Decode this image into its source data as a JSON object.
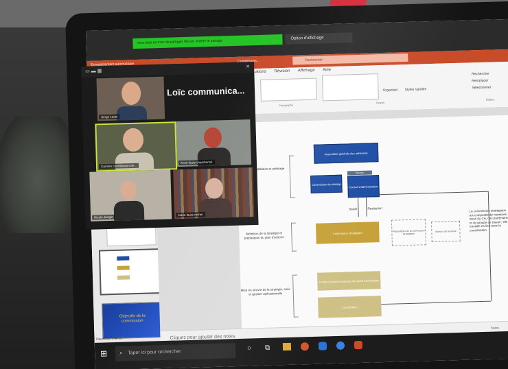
{
  "zoom": {
    "share_bar_text": "Vous êtes en train de partager l'écran. Arrêter le partage",
    "view_options_label": "Option d'affichage",
    "featured_name": "Loïc communica...",
    "participants": [
      {
        "label": "Serge Lavet",
        "tile": "top"
      },
      {
        "label": "Carmen coordination de...",
        "tile": "mid-left"
      },
      {
        "label": "Anne-laure chambenoit",
        "tile": "mid-right"
      },
      {
        "label": "Nicole dengle",
        "tile": "bottom-left"
      },
      {
        "label": "marie-laure rocher",
        "tile": "bottom-right"
      }
    ]
  },
  "powerpoint": {
    "autosave_label": "Enregistrement automatique",
    "doc_title": "Comitésions...",
    "search_placeholder": "Rechercher",
    "tabs": [
      "...ations",
      "Révision",
      "Affichage",
      "Aide"
    ],
    "ribbon_groups": {
      "paragraph": "Paragraphe",
      "drawing": "Dessin",
      "editing": "Édition"
    },
    "ribbon_buttons": {
      "organize": "Organiser",
      "styles": "Styles rapides",
      "find": "Rechercher",
      "replace": "Remplacer",
      "select": "Sélectionner"
    },
    "thumbnail_last_title": "Objectifs de la commission",
    "notes_placeholder": "Cliquez pour ajouter des notes",
    "status_slide": "Diapositive 2 de 10",
    "status_notes": "Notes",
    "slide": {
      "row1_label": "Décisions, validation et arbitrage",
      "row2_label": "Définition de la stratégie et préparation du plan d'actions",
      "row3_label": "Mise en oeuvre de la stratégie, suivi et gestion opérationnelle",
      "box_top": "Assemblée générale des adhérents",
      "box_left": "Commission de pilotage",
      "box_right": "Conseil d'administration",
      "box_mid_tag": "Bureau",
      "box_gold": "Commission stratégique",
      "box_khaki1": "Comité de suivi et groupes de travail thématiques",
      "box_khaki2": "Coordination",
      "box_dashed1": "Propositions de la commission stratégique",
      "box_dashed2": "Acteurs du territoire",
      "note_right": "La commission stratégique est composée de membres issus du CA, des partenaires et du groupe de travail ; elle travaille en lien avec la coordination",
      "arrow_label1": "Saisie",
      "arrow_label2": "Restitution"
    }
  },
  "taskbar": {
    "search_placeholder": "Taper ici pour rechercher"
  },
  "colors": {
    "ppt_orange": "#c94c2a",
    "zoom_green": "#27c427",
    "box_blue": "#1f4ea5",
    "box_gold": "#c7a23a",
    "box_khaki": "#cfc186"
  }
}
